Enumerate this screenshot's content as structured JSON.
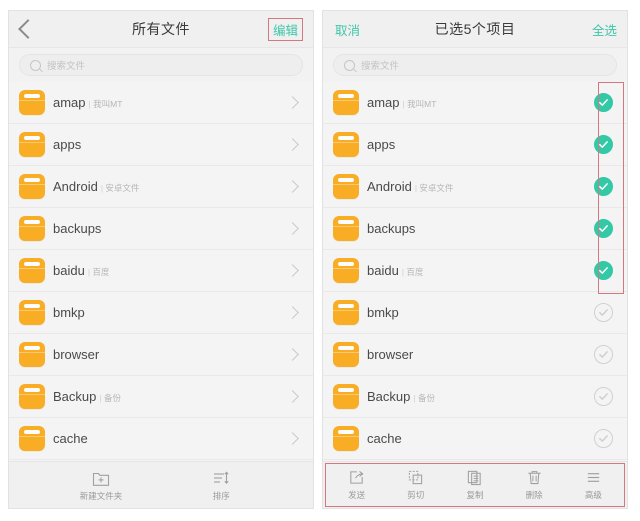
{
  "left_panel": {
    "nav": {
      "back_icon": "back-chevron-icon",
      "title": "所有文件",
      "action_label": "编辑",
      "action_highlighted": true
    },
    "search": {
      "icon": "search-icon",
      "placeholder": "搜索文件",
      "value": ""
    },
    "rows": [
      {
        "name": "amap",
        "sub": "我叫MT",
        "icon": "folder-icon",
        "chevron": "chevron-right-icon"
      },
      {
        "name": "apps",
        "sub": "",
        "icon": "folder-icon",
        "chevron": "chevron-right-icon"
      },
      {
        "name": "Android",
        "sub": "安卓文件",
        "icon": "folder-icon",
        "chevron": "chevron-right-icon"
      },
      {
        "name": "backups",
        "sub": "",
        "icon": "folder-icon",
        "chevron": "chevron-right-icon"
      },
      {
        "name": "baidu",
        "sub": "百度",
        "icon": "folder-icon",
        "chevron": "chevron-right-icon"
      },
      {
        "name": "bmkp",
        "sub": "",
        "icon": "folder-icon",
        "chevron": "chevron-right-icon"
      },
      {
        "name": "browser",
        "sub": "",
        "icon": "folder-icon",
        "chevron": "chevron-right-icon"
      },
      {
        "name": "Backup",
        "sub": "备份",
        "icon": "folder-icon",
        "chevron": "chevron-right-icon"
      },
      {
        "name": "cache",
        "sub": "",
        "icon": "folder-icon",
        "chevron": "chevron-right-icon"
      }
    ],
    "toolbar": [
      {
        "label": "新建文件夹",
        "icon": "new-folder-icon"
      },
      {
        "label": "排序",
        "icon": "sort-icon"
      }
    ]
  },
  "right_panel": {
    "nav": {
      "cancel_label": "取消",
      "title": "已选5个项目",
      "select_all_label": "全选"
    },
    "search": {
      "icon": "search-icon",
      "placeholder": "搜索文件",
      "value": ""
    },
    "selected_count": 5,
    "rows": [
      {
        "name": "amap",
        "sub": "我叫MT",
        "icon": "folder-icon",
        "checked": true,
        "check_icon": "check-circle-filled-icon"
      },
      {
        "name": "apps",
        "sub": "",
        "icon": "folder-icon",
        "checked": true,
        "check_icon": "check-circle-filled-icon"
      },
      {
        "name": "Android",
        "sub": "安卓文件",
        "icon": "folder-icon",
        "checked": true,
        "check_icon": "check-circle-filled-icon"
      },
      {
        "name": "backups",
        "sub": "",
        "icon": "folder-icon",
        "checked": true,
        "check_icon": "check-circle-filled-icon"
      },
      {
        "name": "baidu",
        "sub": "百度",
        "icon": "folder-icon",
        "checked": true,
        "check_icon": "check-circle-filled-icon"
      },
      {
        "name": "bmkp",
        "sub": "",
        "icon": "folder-icon",
        "checked": false,
        "check_icon": "check-circle-outline-icon"
      },
      {
        "name": "browser",
        "sub": "",
        "icon": "folder-icon",
        "checked": false,
        "check_icon": "check-circle-outline-icon"
      },
      {
        "name": "Backup",
        "sub": "备份",
        "icon": "folder-icon",
        "checked": false,
        "check_icon": "check-circle-outline-icon"
      },
      {
        "name": "cache",
        "sub": "",
        "icon": "folder-icon",
        "checked": false,
        "check_icon": "check-circle-outline-icon"
      }
    ],
    "toolbar": [
      {
        "label": "发送",
        "icon": "send-icon"
      },
      {
        "label": "剪切",
        "icon": "cut-icon"
      },
      {
        "label": "复制",
        "icon": "copy-icon"
      },
      {
        "label": "删除",
        "icon": "trash-icon"
      },
      {
        "label": "高级",
        "icon": "menu-lines-icon"
      }
    ],
    "toolbar_highlighted": true
  },
  "colors": {
    "folder": "#f9ad25",
    "accent_teal": "#3fc6a8",
    "check_filled": "#33c9a7",
    "highlight_box": "#d4777f",
    "panel_bg": "#f2f2f2",
    "row_bg": "#f4f4f4",
    "text_primary": "#4a4a4a",
    "text_sub": "#b6b6b6"
  }
}
